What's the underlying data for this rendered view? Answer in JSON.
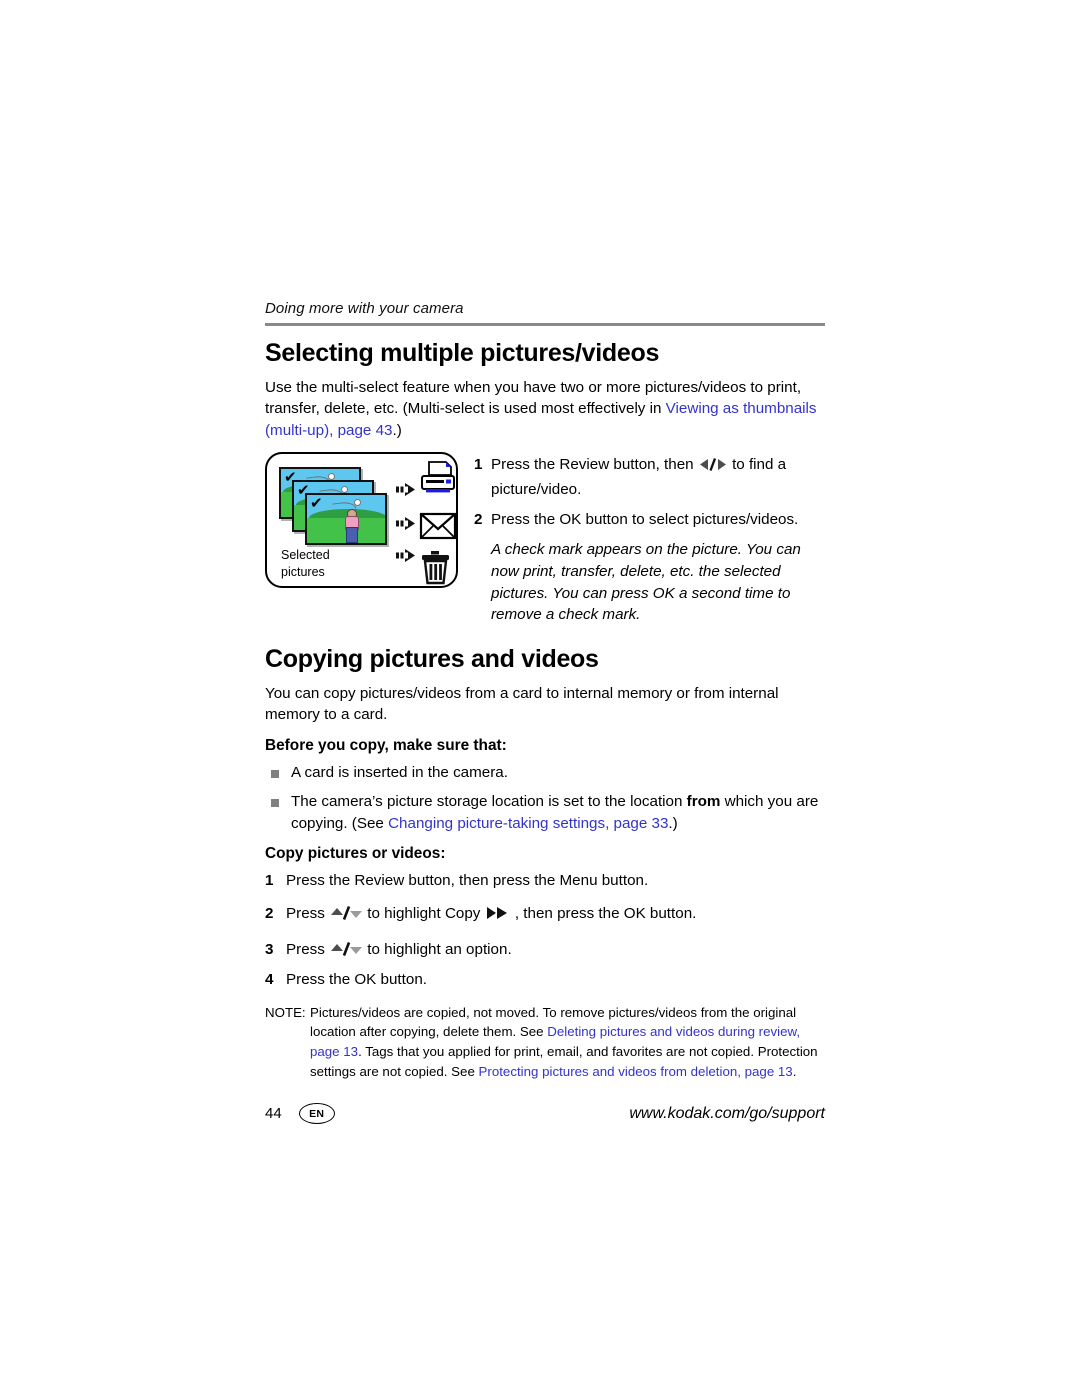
{
  "header": {
    "running_head": "Doing more with your camera"
  },
  "section1": {
    "title": "Selecting multiple pictures/videos",
    "intro_part1": "Use the multi-select feature when you have two or more pictures/videos to print, transfer, delete, etc. (Multi-select is used most effectively in ",
    "intro_link": "Viewing as thumbnails (multi-up), page 43",
    "intro_part2": ".)",
    "figure": {
      "caption_line1": "Selected",
      "caption_line2": "pictures",
      "destination_icons": [
        "printer-icon",
        "envelope-icon",
        "trash-icon"
      ],
      "photo_count": 3,
      "check_glyph": "✔"
    },
    "steps": [
      {
        "num": "1",
        "text_before_icon": "Press the Review button, then ",
        "icon": "left-right-arrows-icon",
        "text_after_icon": " to find a picture/video."
      },
      {
        "num": "2",
        "text_before_icon": "Press the OK button to select pictures/videos.",
        "icon": "",
        "text_after_icon": ""
      }
    ],
    "step_note": "A check mark appears on the picture. You can now print, transfer, delete, etc. the selected pictures. You can press OK a second time to remove a check mark."
  },
  "section2": {
    "title": "Copying pictures and videos",
    "intro": "You can copy pictures/videos from a card to internal memory or from internal memory to a card.",
    "before_heading": "Before you copy, make sure that:",
    "bullets": [
      {
        "text_a": "A card is inserted in the camera.",
        "bold": "",
        "text_b": "",
        "link": "",
        "text_c": ""
      },
      {
        "text_a": "The camera’s picture storage location is set to the location ",
        "bold": "from",
        "text_b": " which you are copying. (See ",
        "link": "Changing picture-taking settings, page 33",
        "text_c": ".)"
      }
    ],
    "copy_heading": "Copy pictures or videos:",
    "copy_steps": [
      {
        "num": "1",
        "a": "Press the Review button, then press the Menu button.",
        "icon1": "",
        "b": "",
        "icon2": "",
        "c": ""
      },
      {
        "num": "2",
        "a": "Press ",
        "icon1": "up-down-arrows-icon",
        "b": " to highlight Copy ",
        "icon2": "double-right-arrow-icon",
        "c": " , then press the OK button."
      },
      {
        "num": "3",
        "a": "Press ",
        "icon1": "up-down-arrows-icon",
        "b": " to highlight an option.",
        "icon2": "",
        "c": ""
      },
      {
        "num": "4",
        "a": "Press the OK button.",
        "icon1": "",
        "b": "",
        "icon2": "",
        "c": ""
      }
    ],
    "note": {
      "label": "NOTE:",
      "part1": "Pictures/videos are copied, not moved. To remove pictures/videos from the original location after copying, delete them. See ",
      "link1": "Deleting pictures and videos during review, page 13",
      "part2": ". Tags that you applied for print, email, and favorites are not copied. Protection settings are not copied. See ",
      "link2": "Protecting pictures and videos from deletion, page 13",
      "part3": "."
    }
  },
  "footer": {
    "page_number": "44",
    "language_badge": "EN",
    "url": "www.kodak.com/go/support"
  },
  "colors": {
    "link_blue": "#3333cc",
    "rule_gray": "#8a8a8a",
    "bullet_gray": "#808080",
    "printer_accent": "#1a1aee"
  }
}
